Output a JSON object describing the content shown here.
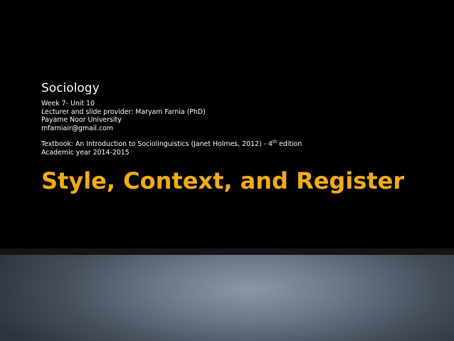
{
  "slide": {
    "subject": "Sociology",
    "week": "Week  7- Unit 10",
    "lecturer": "Lecturer and slide provider: Maryam Farnia (PhD)",
    "university": "Payame Noor University",
    "email": "mfarniair@gmail.com",
    "textbook_pre": "Textbook: An Introduction to Sociolinguistics (Janet Holmes, 2012) -  4",
    "textbook_sup": "th",
    "textbook_post": " edition",
    "academic_year": "Academic year 2014-2015",
    "title": "Style, Context, and Register"
  },
  "colors": {
    "background": "#000000",
    "title": "#f2ac18",
    "text": "#ffffff",
    "panel": "#6a7585"
  }
}
